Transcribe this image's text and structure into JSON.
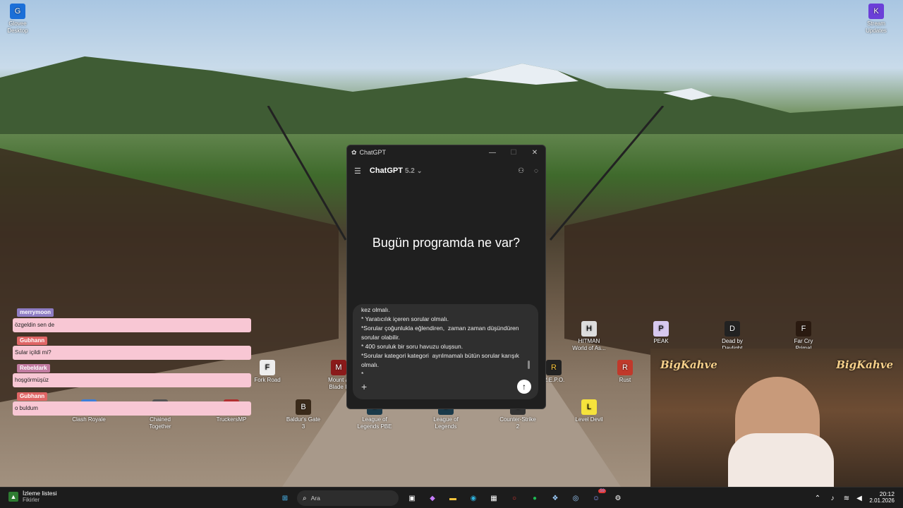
{
  "desktop_icons": [
    {
      "label": "Glovee\nDesktop",
      "icon": "app-icon"
    },
    {
      "label": "Stream\nUpdates",
      "icon": "app-icon"
    },
    {
      "label": "HITMAN\nWorld of As...",
      "icon": "game-icon"
    },
    {
      "label": "PEAK",
      "icon": "game-icon"
    },
    {
      "label": "Dead by\nDaylight",
      "icon": "game-icon"
    },
    {
      "label": "Far Cry\nPrimal",
      "icon": "game-icon"
    },
    {
      "label": "Fork Road",
      "icon": "game-icon"
    },
    {
      "label": "Mount &\nBlade II",
      "icon": "game-icon"
    },
    {
      "label": "R.E.P.O.",
      "icon": "game-icon"
    },
    {
      "label": "Rust",
      "icon": "game-icon"
    },
    {
      "label": "Clash Royale",
      "icon": "game-icon"
    },
    {
      "label": "Chained\nTogether",
      "icon": "game-icon"
    },
    {
      "label": "TruckersMP",
      "icon": "game-icon"
    },
    {
      "label": "Baldur's Gate\n3",
      "icon": "game-icon"
    },
    {
      "label": "League of\nLegends PBE",
      "icon": "game-icon"
    },
    {
      "label": "League of\nLegends",
      "icon": "game-icon"
    },
    {
      "label": "Counter-Strike\n2",
      "icon": "game-icon"
    },
    {
      "label": "Level Devil",
      "icon": "game-icon"
    }
  ],
  "chatgpt": {
    "window_title": "ChatGPT",
    "model_name": "ChatGPT",
    "model_version": "5.2",
    "greeting": "Bugün programda ne var?",
    "composer_text": "kez olmalı.\n* Yaratıcılık içeren sorular olmalı.\n*Sorular çoğunlukla eğlendiren,  zaman zaman düşündüren sorular olabilir.\n* 400 soruluk bir soru havuzu oluşsun.\n*Sorular kategori kategori  ayrılmamalı bütün sorular karışık olmalı.\n*"
  },
  "chat_overlay": [
    {
      "user": "merrymoon",
      "user_color": "#8e7cc3",
      "message": "özgeldin sen de"
    },
    {
      "user": "Gubhann",
      "user_color": "#e06666",
      "message": "Sular içildi mi?"
    },
    {
      "user": "Rebeldark",
      "user_color": "#c27ba0",
      "message": "hoşgörmüşüz"
    },
    {
      "user": "Gubhann",
      "user_color": "#e06666",
      "message": "o buldum"
    }
  ],
  "webcam": {
    "brand_left": "BigKahve",
    "brand_right": "BigKahve"
  },
  "taskbar": {
    "widget_title": "İzleme listesi",
    "widget_subtitle": "Fikirler",
    "search_placeholder": "Ara",
    "time": "20:12",
    "date": "2.01.2026",
    "discord_badge": "59"
  },
  "colors": {
    "accent": "#10a37f",
    "chat_bg": "#f8c7d4",
    "window_bg": "#1f1f1f"
  }
}
